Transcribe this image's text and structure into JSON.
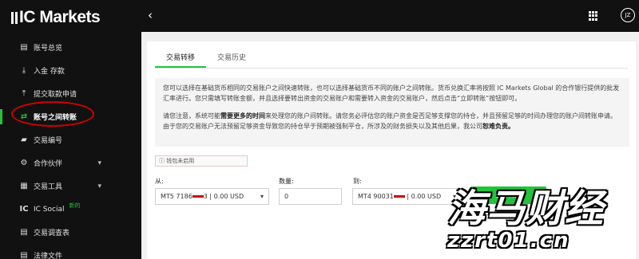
{
  "brand": {
    "logo_text": "IC Markets",
    "accent": "#22c33a",
    "annotation_color": "#d10000"
  },
  "topbar": {
    "back_icon": "chevron-left-icon",
    "apps_icon": "grid-icon",
    "avatar_initials": "JZ"
  },
  "sidebar": {
    "items": [
      {
        "label": "账号总览",
        "icon": "dashboard-icon",
        "glyph": "▤"
      },
      {
        "label": "入金 存款",
        "icon": "deposit-icon",
        "glyph": "⤓"
      },
      {
        "label": "提交取款申请",
        "icon": "withdraw-icon",
        "glyph": "⤒"
      },
      {
        "label": "账号之间转账",
        "icon": "transfer-icon",
        "glyph": "⇄",
        "active": true
      },
      {
        "label": "交易编号",
        "icon": "chart-icon",
        "glyph": "▰"
      },
      {
        "label": "合作伙伴",
        "icon": "partner-icon",
        "glyph": "⚙",
        "expandable": true
      },
      {
        "label": "交易工具",
        "icon": "tools-icon",
        "glyph": "▦",
        "expandable": true
      },
      {
        "label": "IC Social",
        "icon": "ic-social-icon",
        "badge": "新的"
      },
      {
        "label": "交易调查表",
        "icon": "survey-icon",
        "glyph": "▤"
      },
      {
        "label": "法律文件",
        "icon": "document-icon",
        "glyph": "▤"
      }
    ]
  },
  "main": {
    "tabs": [
      {
        "label": "交易转移",
        "active": true
      },
      {
        "label": "交易历史"
      }
    ],
    "info_para1": "您可以选择在基础货币相同的交易账户之间快速转账，也可以选择基础货币不同的账户之间转账。货币兑换汇率将按照 IC Markets Global 的合作银行提供的批发汇率进行。您只需填写转账金额，并且选择要转出资金的交易账户和需要转入资金的交易账户，然后点击“立即转账”按钮即可。",
    "info_para2_a": "请您注意，系统可能",
    "info_para2_b": "需要更多的时间",
    "info_para2_c": "来处理您的账户间转账。请您务必评估您的账户资金是否足够支撑您的持仓，并且预留足够的时间办理您的账户间转账申请。由于您的交易账户无法预留足够资金导致您的持仓早于预期被强制平仓，所涉及的财务损失以及其他后果，我公司",
    "info_para2_d": "恕难负责。",
    "wallet_note": "钱包未启用",
    "from_label": "从:",
    "from_value_a": "MT5 7186",
    "from_value_b": "3 | 0.00 USD",
    "amount_label": "数量:",
    "amount_value": "0",
    "to_label": "到:",
    "to_value_a": "MT4 90031",
    "to_value_b": " | 0.00 USD",
    "submit_label": "立即转账"
  },
  "watermark": {
    "line1": "海马财经",
    "line2": "zzrt01.cn"
  }
}
